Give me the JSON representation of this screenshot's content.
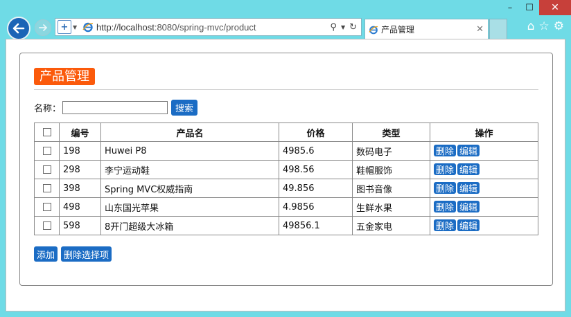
{
  "browser": {
    "url_host": "http://localhost",
    "url_rest": ":8080/spring-mvc/product",
    "tab_title": "产品管理",
    "window_controls": {
      "minimize": "–",
      "maximize": "☐",
      "close": "✕"
    }
  },
  "page": {
    "title": "产品管理",
    "search": {
      "label": "名称：",
      "value": "",
      "button": "搜索"
    },
    "table": {
      "headers": {
        "id": "编号",
        "name": "产品名",
        "price": "价格",
        "type": "类型",
        "ops": "操作"
      },
      "rows": [
        {
          "id": "198",
          "name": "Huwei P8",
          "price": "4985.6",
          "type": "数码电子"
        },
        {
          "id": "298",
          "name": "李宁运动鞋",
          "price": "498.56",
          "type": "鞋帽服饰"
        },
        {
          "id": "398",
          "name": "Spring MVC权威指南",
          "price": "49.856",
          "type": "图书音像"
        },
        {
          "id": "498",
          "name": "山东国光苹果",
          "price": "4.9856",
          "type": "生鲜水果"
        },
        {
          "id": "598",
          "name": "8开门超级大冰箱",
          "price": "49856.1",
          "type": "五金家电"
        }
      ],
      "row_actions": {
        "delete": "删除",
        "edit": "编辑"
      }
    },
    "actions": {
      "add": "添加",
      "delete_selected": "删除选择项"
    }
  },
  "colors": {
    "title_bg": "#fb5a0b",
    "button_bg": "#1b6cc4",
    "chrome_bg": "#6fdbe6"
  }
}
